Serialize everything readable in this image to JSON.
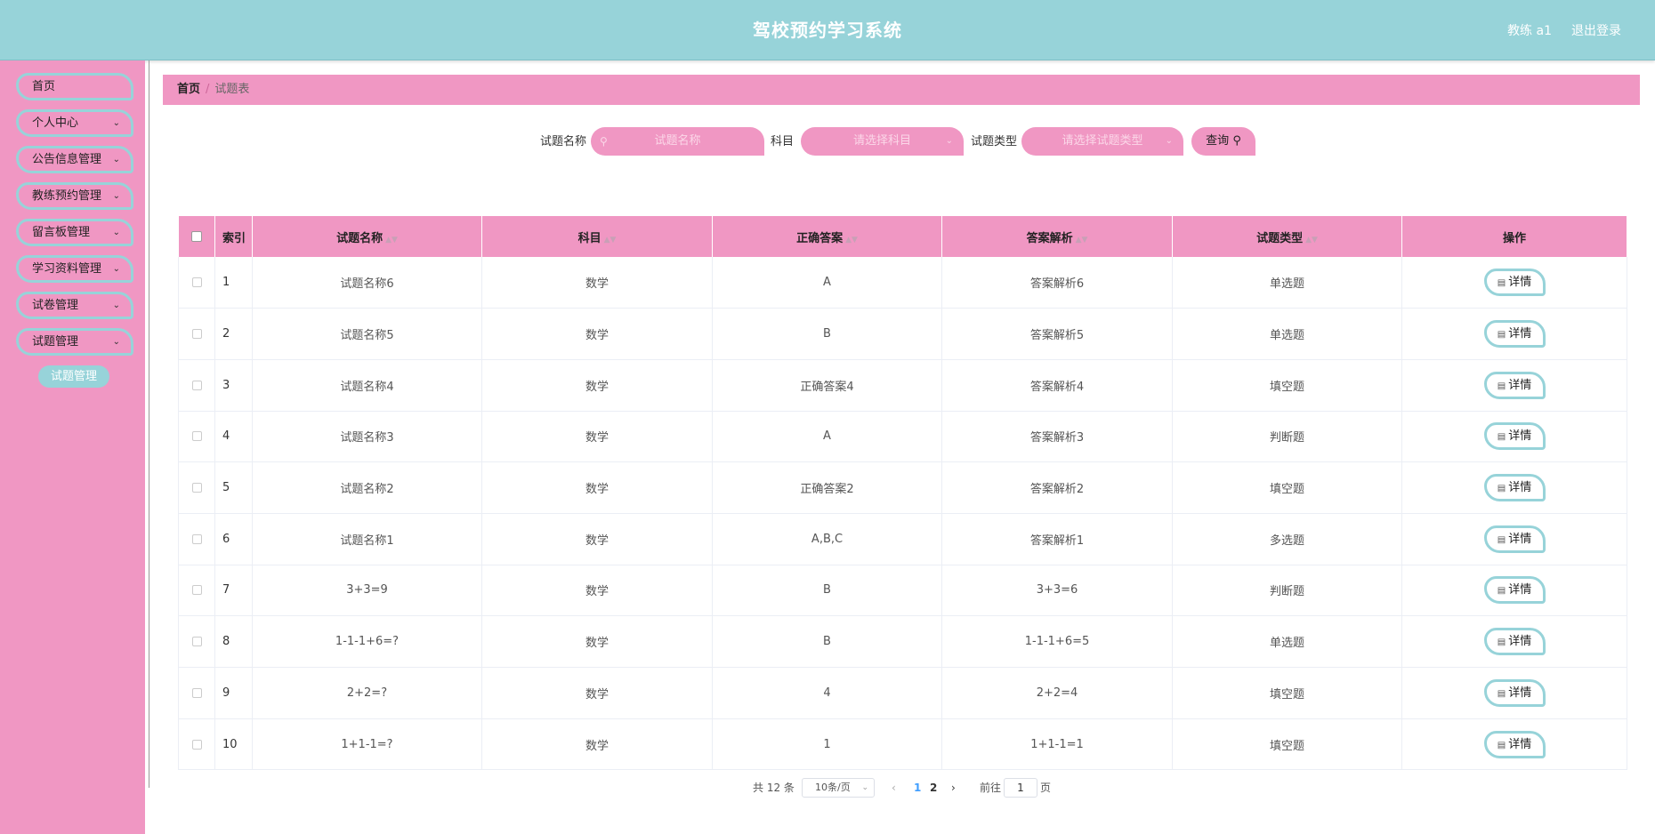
{
  "header": {
    "title": "驾校预约学习系统",
    "user": "教练 a1",
    "logout": "退出登录"
  },
  "sidebar": {
    "items": [
      {
        "label": "首页",
        "expandable": false
      },
      {
        "label": "个人中心",
        "expandable": true
      },
      {
        "label": "公告信息管理",
        "expandable": true
      },
      {
        "label": "教练预约管理",
        "expandable": true
      },
      {
        "label": "留言板管理",
        "expandable": true
      },
      {
        "label": "学习资料管理",
        "expandable": true
      },
      {
        "label": "试卷管理",
        "expandable": true
      },
      {
        "label": "试题管理",
        "expandable": true
      }
    ],
    "active_sub": "试题管理"
  },
  "breadcrumb": {
    "home": "首页",
    "current": "试题表"
  },
  "search": {
    "name_label": "试题名称",
    "name_placeholder": "试题名称",
    "subject_label": "科目",
    "subject_placeholder": "请选择科目",
    "type_label": "试题类型",
    "type_placeholder": "请选择试题类型",
    "button": "查询"
  },
  "table": {
    "headers": [
      "索引",
      "试题名称",
      "科目",
      "正确答案",
      "答案解析",
      "试题类型",
      "操作"
    ],
    "action_label": "详情",
    "rows": [
      {
        "index": "1",
        "name": "试题名称6",
        "subject": "数学",
        "answer": "A",
        "analysis": "答案解析6",
        "type": "单选题"
      },
      {
        "index": "2",
        "name": "试题名称5",
        "subject": "数学",
        "answer": "B",
        "analysis": "答案解析5",
        "type": "单选题"
      },
      {
        "index": "3",
        "name": "试题名称4",
        "subject": "数学",
        "answer": "正确答案4",
        "analysis": "答案解析4",
        "type": "填空题"
      },
      {
        "index": "4",
        "name": "试题名称3",
        "subject": "数学",
        "answer": "A",
        "analysis": "答案解析3",
        "type": "判断题"
      },
      {
        "index": "5",
        "name": "试题名称2",
        "subject": "数学",
        "answer": "正确答案2",
        "analysis": "答案解析2",
        "type": "填空题"
      },
      {
        "index": "6",
        "name": "试题名称1",
        "subject": "数学",
        "answer": "A,B,C",
        "analysis": "答案解析1",
        "type": "多选题"
      },
      {
        "index": "7",
        "name": "3+3=9",
        "subject": "数学",
        "answer": "B",
        "analysis": "3+3=6",
        "type": "判断题"
      },
      {
        "index": "8",
        "name": "1-1-1+6=?",
        "subject": "数学",
        "answer": "B",
        "analysis": "1-1-1+6=5",
        "type": "单选题"
      },
      {
        "index": "9",
        "name": "2+2=?",
        "subject": "数学",
        "answer": "4",
        "analysis": "2+2=4",
        "type": "填空题"
      },
      {
        "index": "10",
        "name": "1+1-1=?",
        "subject": "数学",
        "answer": "1",
        "analysis": "1+1-1=1",
        "type": "填空题"
      }
    ]
  },
  "pagination": {
    "total": "共 12 条",
    "page_size": "10条/页",
    "pages": [
      "1",
      "2"
    ],
    "current_page": "1",
    "goto_label": "前往",
    "goto_value": "1",
    "page_unit": "页"
  }
}
